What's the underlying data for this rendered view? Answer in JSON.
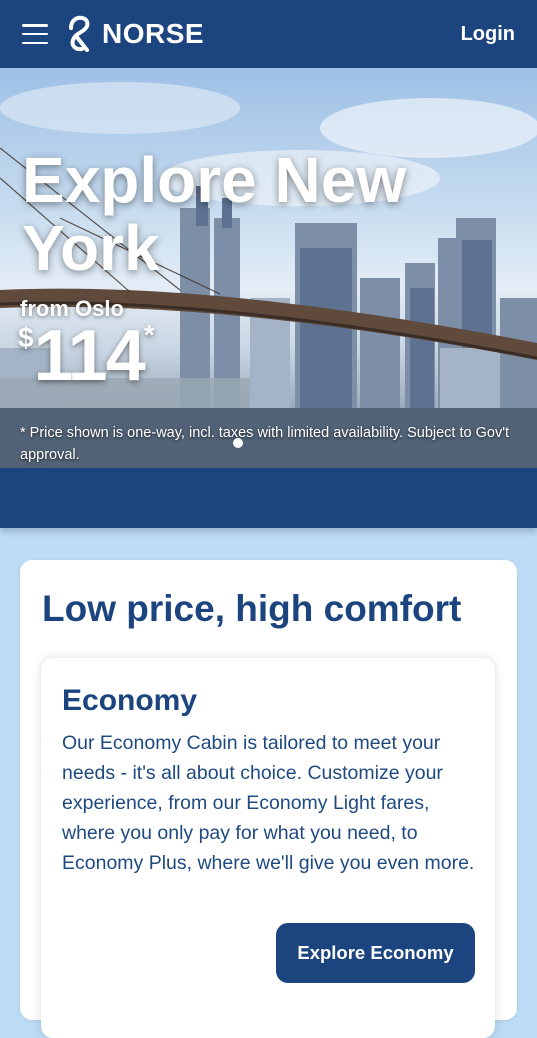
{
  "header": {
    "brand": "NORSE",
    "login_label": "Login"
  },
  "hero": {
    "title": "Explore New York",
    "from_label": "from Oslo",
    "currency": "$",
    "price": "114",
    "price_marker": "*",
    "note": "* Price shown is one-way, incl. taxes with limited availability. Subject to Gov't approval."
  },
  "section": {
    "title": "Low price, high comfort",
    "cabin": {
      "title": "Economy",
      "description": "Our Economy Cabin is tailored to meet your needs - it's all about choice. Customize your experience, from our Economy Light fares, where you only pay for what you need, to Economy Plus, where we'll give you even more.",
      "button_label": "Explore Economy"
    }
  },
  "colors": {
    "brand_navy": "#1c4580",
    "page_background": "#bcdcf6",
    "text_blue": "#1f4a80"
  },
  "icons": {
    "menu": "hamburger-menu-icon",
    "logo": "norse-logo-mark-icon"
  }
}
